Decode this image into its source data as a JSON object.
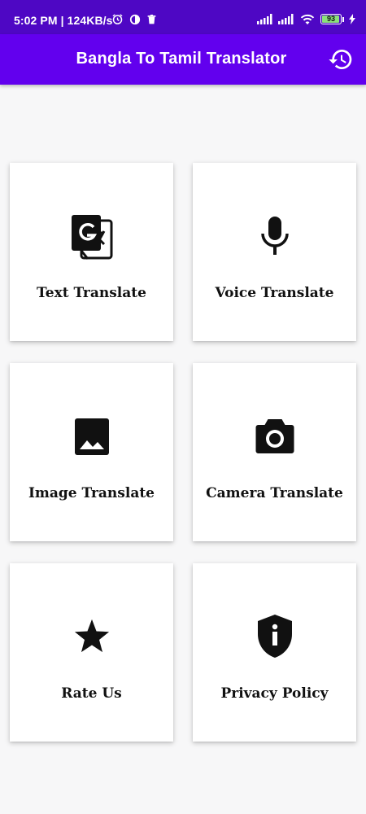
{
  "status_bar": {
    "time": "5:02 PM | 124KB/s",
    "battery": "93",
    "icons": [
      "alarm-icon",
      "data-saver-icon",
      "delete-icon",
      "signal-icon",
      "signal-icon",
      "wifi-icon",
      "battery-icon",
      "charging-icon"
    ]
  },
  "app_bar": {
    "title": "Bangla To Tamil Translator",
    "history_icon": "history-icon"
  },
  "cards": [
    {
      "label": "Text Translate",
      "icon": "google-translate-icon"
    },
    {
      "label": "Voice Translate",
      "icon": "microphone-icon"
    },
    {
      "label": "Image Translate",
      "icon": "image-icon"
    },
    {
      "label": "Camera Translate",
      "icon": "camera-icon"
    },
    {
      "label": "Rate Us",
      "icon": "star-icon"
    },
    {
      "label": "Privacy Policy",
      "icon": "privacy-shield-icon"
    }
  ],
  "colors": {
    "status_bar": "#4e07c4",
    "app_bar": "#6200ee",
    "background": "#f7f7f8",
    "card": "#ffffff",
    "text": "#111111"
  }
}
